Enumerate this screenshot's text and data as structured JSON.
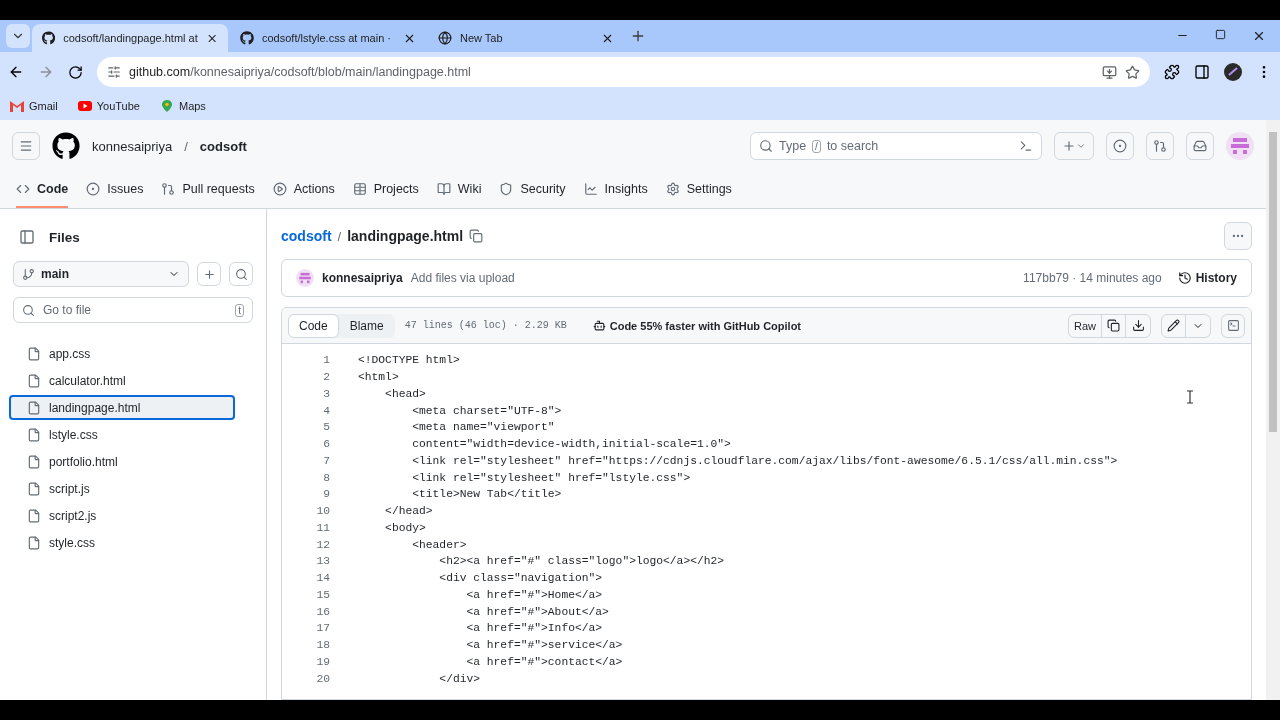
{
  "browser": {
    "tabs": [
      {
        "title": "codsoft/landingpage.html at",
        "kind": "github",
        "selected": true
      },
      {
        "title": "codsoft/lstyle.css at main ·",
        "kind": "github",
        "selected": false
      },
      {
        "title": "New Tab",
        "kind": "globe",
        "selected": false
      }
    ],
    "address": {
      "host": "github.com",
      "path": "/konnesaipriya/codsoft/blob/main/landingpage.html"
    },
    "bookmarks": [
      {
        "label": "Gmail",
        "color": "#ea4335"
      },
      {
        "label": "YouTube",
        "color": "#ff0000"
      },
      {
        "label": "Maps",
        "color": "#34a853"
      }
    ]
  },
  "repo": {
    "owner": "konnesaipriya",
    "separator": "/",
    "name": "codsoft",
    "search": {
      "before": "Type",
      "key": "/",
      "after": "to search"
    }
  },
  "nav": [
    {
      "label": "Code",
      "selected": true
    },
    {
      "label": "Issues",
      "selected": false
    },
    {
      "label": "Pull requests",
      "selected": false
    },
    {
      "label": "Actions",
      "selected": false
    },
    {
      "label": "Projects",
      "selected": false
    },
    {
      "label": "Wiki",
      "selected": false
    },
    {
      "label": "Security",
      "selected": false
    },
    {
      "label": "Insights",
      "selected": false
    },
    {
      "label": "Settings",
      "selected": false
    }
  ],
  "sidebar": {
    "title": "Files",
    "branch": "main",
    "search": {
      "placeholder": "Go to file",
      "shortcut": "t"
    },
    "files": [
      {
        "name": "app.css",
        "selected": false
      },
      {
        "name": "calculator.html",
        "selected": false
      },
      {
        "name": "landingpage.html",
        "selected": true
      },
      {
        "name": "lstyle.css",
        "selected": false
      },
      {
        "name": "portfolio.html",
        "selected": false
      },
      {
        "name": "script.js",
        "selected": false
      },
      {
        "name": "script2.js",
        "selected": false
      },
      {
        "name": "style.css",
        "selected": false
      }
    ]
  },
  "breadcrumb": {
    "repo": "codsoft",
    "separator": "/",
    "file": "landingpage.html"
  },
  "commit": {
    "author": "konnesaipriya",
    "message": "Add files via upload",
    "meta": "117bb79 · 14 minutes ago",
    "history": "History"
  },
  "file_toolbar": {
    "views": [
      {
        "label": "Code",
        "selected": true
      },
      {
        "label": "Blame",
        "selected": false
      }
    ],
    "info": "47 lines (46 loc) · 2.29 KB",
    "copilot": "Code 55% faster with GitHub Copilot",
    "raw": "Raw"
  },
  "code": [
    {
      "number": "1",
      "text": "<!DOCTYPE html>"
    },
    {
      "number": "2",
      "text": "<html>"
    },
    {
      "number": "3",
      "text": "    <head>"
    },
    {
      "number": "4",
      "text": "        <meta charset=\"UTF-8\">"
    },
    {
      "number": "5",
      "text": "        <meta name=\"viewport\""
    },
    {
      "number": "6",
      "text": "        content=\"width=device-width,initial-scale=1.0\">"
    },
    {
      "number": "7",
      "text": "        <link rel=\"stylesheet\" href=\"https://cdnjs.cloudflare.com/ajax/libs/font-awesome/6.5.1/css/all.min.css\">"
    },
    {
      "number": "8",
      "text": "        <link rel=\"stylesheet\" href=\"lstyle.css\">"
    },
    {
      "number": "9",
      "text": "        <title>New Tab</title>"
    },
    {
      "number": "10",
      "text": "    </head>"
    },
    {
      "number": "11",
      "text": "    <body>"
    },
    {
      "number": "12",
      "text": "        <header>"
    },
    {
      "number": "13",
      "text": "            <h2><a href=\"#\" class=\"logo\">logo</a></h2>"
    },
    {
      "number": "14",
      "text": "            <div class=\"navigation\">"
    },
    {
      "number": "15",
      "text": "                <a href=\"#\">Home</a>"
    },
    {
      "number": "16",
      "text": "                <a href=\"#\">About</a>"
    },
    {
      "number": "17",
      "text": "                <a href=\"#\">Info</a>"
    },
    {
      "number": "18",
      "text": "                <a href=\"#\">service</a>"
    },
    {
      "number": "19",
      "text": "                <a href=\"#\">contact</a>"
    },
    {
      "number": "20",
      "text": "            </div>"
    }
  ]
}
